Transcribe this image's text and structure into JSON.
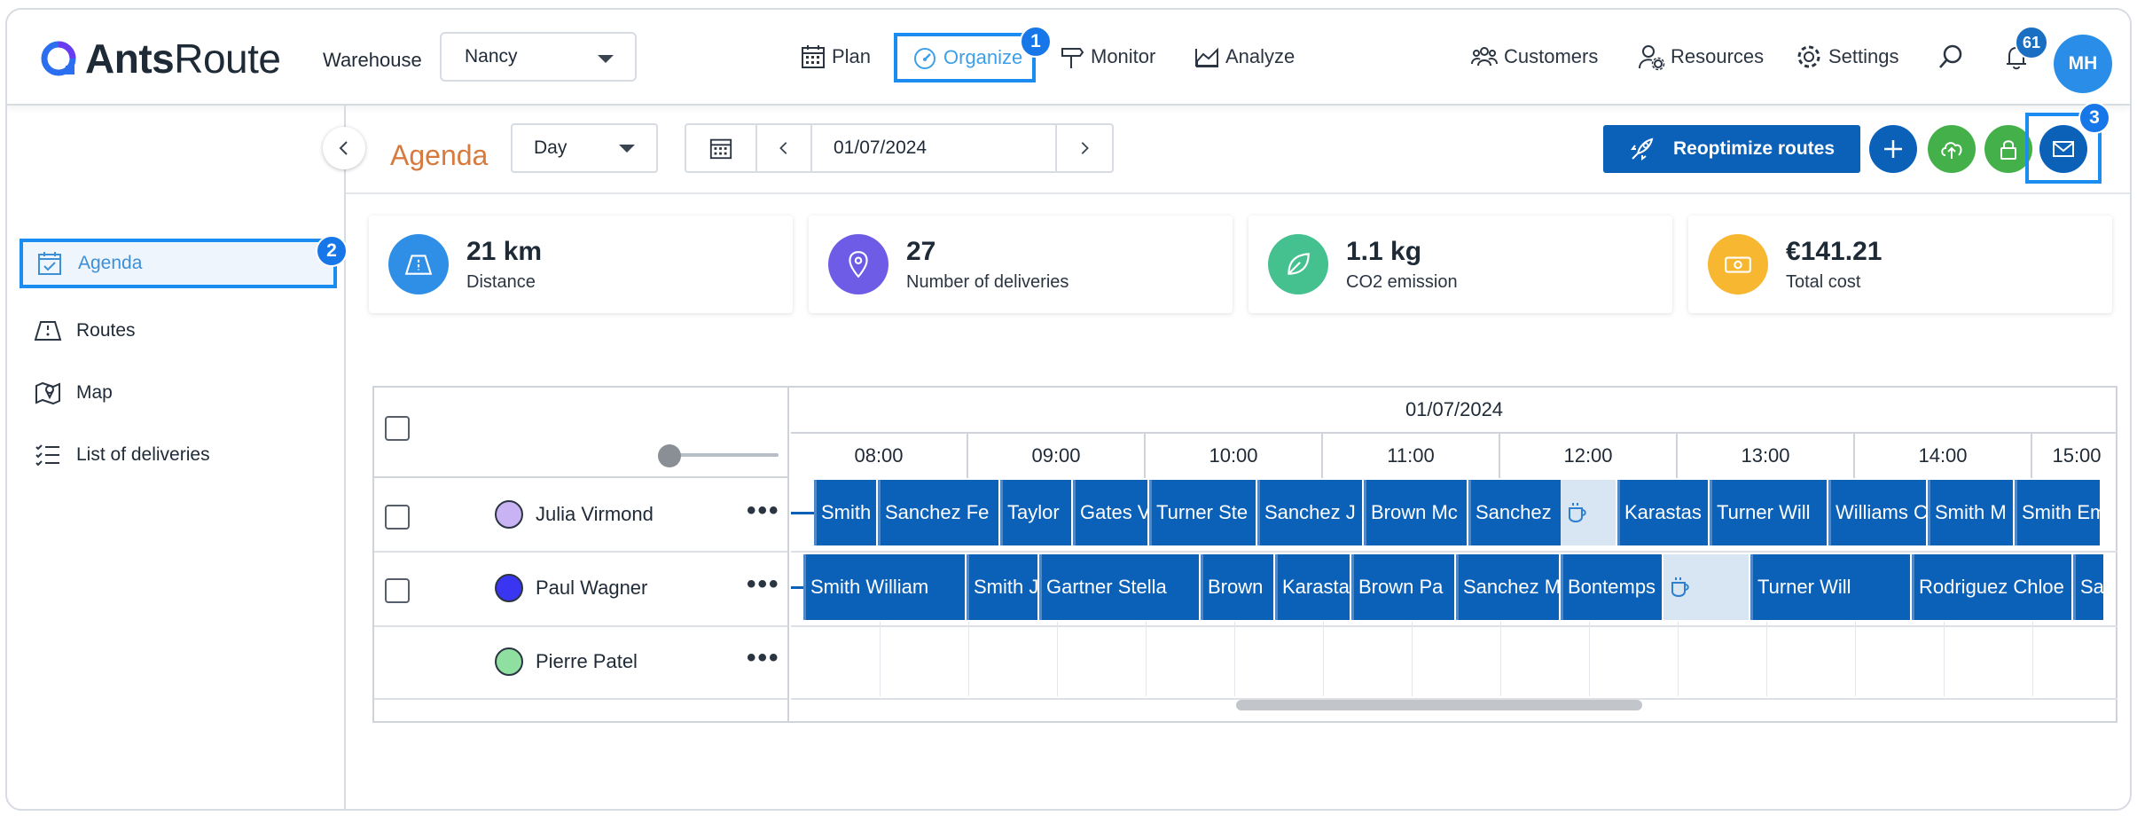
{
  "app": {
    "logo_bold": "Ants",
    "logo_light": "Route"
  },
  "header": {
    "warehouse_label": "Warehouse",
    "warehouse_value": "Nancy",
    "nav": {
      "plan": "Plan",
      "organize": "Organize",
      "monitor": "Monitor",
      "analyze": "Analyze"
    },
    "right_nav": {
      "customers": "Customers",
      "resources": "Resources",
      "settings": "Settings"
    },
    "notifications_count": "61",
    "user_initials": "MH"
  },
  "steps": {
    "one": "1",
    "two": "2",
    "three": "3"
  },
  "sidebar": {
    "items": [
      {
        "label": "Agenda",
        "icon": "calendar-check-icon"
      },
      {
        "label": "Routes",
        "icon": "road-icon"
      },
      {
        "label": "Map",
        "icon": "map-pin-icon"
      },
      {
        "label": "List of deliveries",
        "icon": "checklist-icon"
      }
    ]
  },
  "toolbar": {
    "title": "Agenda",
    "view_mode": "Day",
    "date": "01/07/2024",
    "reoptimize_label": "Reoptimize routes"
  },
  "kpis": [
    {
      "value": "21 km",
      "label": "Distance",
      "color": "#2f8fe6"
    },
    {
      "value": "27",
      "label": "Number of deliveries",
      "color": "#6f5ce6"
    },
    {
      "value": "1.1 kg",
      "label": "CO2 emission",
      "color": "#45c08f"
    },
    {
      "value": "€141.21",
      "label": "Total cost",
      "color": "#f7b731"
    }
  ],
  "timeline": {
    "date": "01/07/2024",
    "hours": [
      "08:00",
      "09:00",
      "10:00",
      "11:00",
      "12:00",
      "13:00",
      "14:00",
      "15:00"
    ],
    "resources": [
      {
        "name": "Julia Virmond",
        "color": "#c9b3f5"
      },
      {
        "name": "Paul Wagner",
        "color": "#3a35f0"
      },
      {
        "name": "Pierre Patel",
        "color": "#8fe0a0"
      }
    ],
    "row1": [
      "Smith",
      "Sanchez Fe",
      "Taylor",
      "Gates V",
      "Turner Ste",
      "Sanchez J",
      "Brown Mc",
      "Sanchez",
      "Karastas",
      "Turner Will",
      "Williams C",
      "Smith M",
      "Smith Em"
    ],
    "row2": [
      "Smith William",
      "Smith J",
      "Gartner Stella",
      "Brown",
      "Karasta",
      "Brown Pa",
      "Sanchez M",
      "Bontemps",
      "Turner Will",
      "Rodriguez Chloe",
      "Sa"
    ]
  },
  "colors": {
    "accent": "#1b8cf0",
    "primary": "#0b61b8",
    "agenda_title": "#d77a3d"
  }
}
